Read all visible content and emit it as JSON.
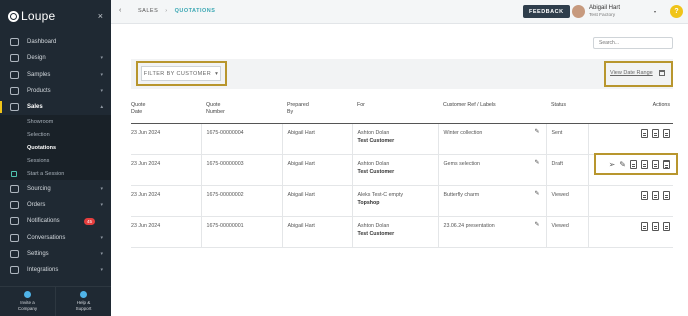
{
  "app": {
    "name": "Loupe",
    "close_glyph": "×"
  },
  "sidebar": {
    "items": [
      {
        "label": "Dashboard",
        "icon": "dashboard-icon",
        "chevron": ""
      },
      {
        "label": "Design",
        "icon": "design-icon",
        "chevron": "▾"
      },
      {
        "label": "Samples",
        "icon": "samples-icon",
        "chevron": "▾"
      },
      {
        "label": "Products",
        "icon": "products-icon",
        "chevron": "▾"
      },
      {
        "label": "Sales",
        "icon": "sales-icon",
        "chevron": "▴",
        "active": true
      }
    ],
    "sales_sub": [
      "Showroom",
      "Selection",
      "Quotations",
      "Sessions",
      "Start a Session"
    ],
    "items_after": [
      {
        "label": "Sourcing",
        "icon": "sourcing-icon",
        "chevron": "▾"
      },
      {
        "label": "Orders",
        "icon": "orders-icon",
        "chevron": "▾"
      },
      {
        "label": "Notifications",
        "icon": "bell-icon",
        "chevron": "",
        "badge": "45"
      },
      {
        "label": "Conversations",
        "icon": "chat-icon",
        "chevron": "▾"
      },
      {
        "label": "Settings",
        "icon": "settings-icon",
        "chevron": "▾"
      },
      {
        "label": "Integrations",
        "icon": "integrations-icon",
        "chevron": "▾"
      }
    ],
    "bottom": {
      "invite_line1": "Invite a",
      "invite_line2": "Company",
      "help_line1": "Help &",
      "help_line2": "Support"
    }
  },
  "topbar": {
    "back_glyph": "‹",
    "crumb1": "SALES",
    "crumb_sep": "›",
    "crumb2": "QUOTATIONS",
    "feedback": "FEEDBACK",
    "user_name": "Abigail Hart",
    "user_company": "Test Factory",
    "user_caret": "▾",
    "help_glyph": "?"
  },
  "main": {
    "search_placeholder": "Search...",
    "filter_label": "FILTER BY CUSTOMER",
    "filter_caret": "▾",
    "date_range": "View Date Range"
  },
  "table": {
    "headers": {
      "date_1": "Quote",
      "date_2": "Date",
      "number_1": "Quote",
      "number_2": "Number",
      "prepared_1": "Prepared",
      "prepared_2": "By",
      "for": "For",
      "ref": "Customer Ref / Labels",
      "status": "Status",
      "actions": "Actions"
    },
    "rows": [
      {
        "date": "23 Jun 2024",
        "number": "1675-00000004",
        "prepared": "Abigail Hart",
        "for_person": "Ashton Dolan",
        "for_company": "Test Customer",
        "ref": "Winter collection",
        "status": "Sent"
      },
      {
        "date": "23 Jun 2024",
        "number": "1675-00000003",
        "prepared": "Abigail Hart",
        "for_person": "Ashton Dolan",
        "for_company": "Test Customer",
        "ref": "Gems selection",
        "status": "Draft"
      },
      {
        "date": "23 Jun 2024",
        "number": "1675-00000002",
        "prepared": "Abigail Hart",
        "for_person": "Aleks Test-C empty",
        "for_company": "Topshop",
        "ref": "Butterfly charm",
        "status": "Viewed"
      },
      {
        "date": "23 Jun 2024",
        "number": "1675-00000001",
        "prepared": "Abigail Hart",
        "for_person": "Ashton Dolan",
        "for_company": "Test Customer",
        "ref": "23.06.24 presentation",
        "status": "Viewed"
      }
    ]
  },
  "colors": {
    "sidebar_bg": "#1f2933",
    "accent_teal": "#3aa7b3",
    "highlight_gold": "#b8962e",
    "active_bar": "#f0c419",
    "badge_red": "#e53e3e"
  }
}
